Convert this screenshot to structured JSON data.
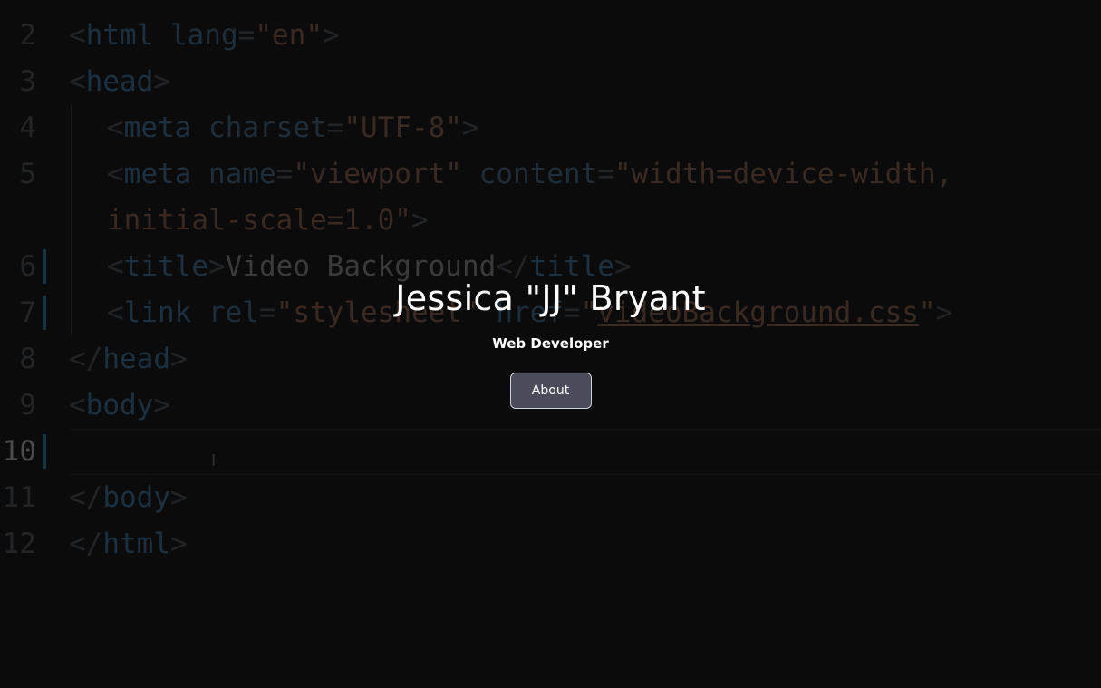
{
  "background_code": {
    "lines": [
      {
        "num": "2",
        "html": "<span class='br'>&lt;</span><span class='tag'>html</span> <span class='attr'>lang</span><span class='br'>=</span><span class='str'>\"en\"</span><span class='br'>&gt;</span>",
        "indent": 0
      },
      {
        "num": "3",
        "html": "<span class='br'>&lt;</span><span class='tag'>head</span><span class='br'>&gt;</span>",
        "indent": 0
      },
      {
        "num": "4",
        "html": "<span class='br'>&lt;</span><span class='tag'>meta</span> <span class='attr'>charset</span><span class='br'>=</span><span class='str'>\"UTF-8\"</span><span class='br'>&gt;</span>",
        "indent": 1
      },
      {
        "num": "5",
        "html": "<span class='br'>&lt;</span><span class='tag'>meta</span> <span class='attr'>name</span><span class='br'>=</span><span class='str'>\"viewport\"</span> <span class='attr'>content</span><span class='br'>=</span><span class='str'>\"width=device-width,</span>",
        "indent": 1
      },
      {
        "num": "",
        "html": "<span class='str'>initial-scale=1.0\"</span><span class='br'>&gt;</span>",
        "indent": 1
      },
      {
        "num": "6",
        "html": "<span class='br'>&lt;</span><span class='tag'>title</span><span class='br'>&gt;</span><span class='txt'>Video Background</span><span class='br'>&lt;/</span><span class='tag'>title</span><span class='br'>&gt;</span>",
        "indent": 1,
        "mark": true
      },
      {
        "num": "7",
        "html": "<span class='br'>&lt;</span><span class='tag'>link</span> <span class='attr'>rel</span><span class='br'>=</span><span class='str'>\"stylesheet\"</span> <span class='attr'>href</span><span class='br'>=</span><span class='str'>\"<span class='underline'>videoBackground.css</span>\"</span><span class='br'>&gt;</span>",
        "indent": 1,
        "mark": true
      },
      {
        "num": "8",
        "html": "<span class='br'>&lt;/</span><span class='tag'>head</span><span class='br'>&gt;</span>",
        "indent": 0
      },
      {
        "num": "9",
        "html": "<span class='br'>&lt;</span><span class='tag'>body</span><span class='br'>&gt;</span>",
        "indent": 0
      },
      {
        "num": "10",
        "html": "",
        "indent": 0,
        "active": true,
        "mark": true
      },
      {
        "num": "11",
        "html": "<span class='br'>&lt;/</span><span class='tag'>body</span><span class='br'>&gt;</span>",
        "indent": 0
      },
      {
        "num": "12",
        "html": "<span class='br'>&lt;/</span><span class='tag'>html</span><span class='br'>&gt;</span>",
        "indent": 0
      }
    ]
  },
  "hero": {
    "name": "Jessica \"JJ\" Bryant",
    "subtitle": "Web Developer",
    "about_label": "About"
  }
}
